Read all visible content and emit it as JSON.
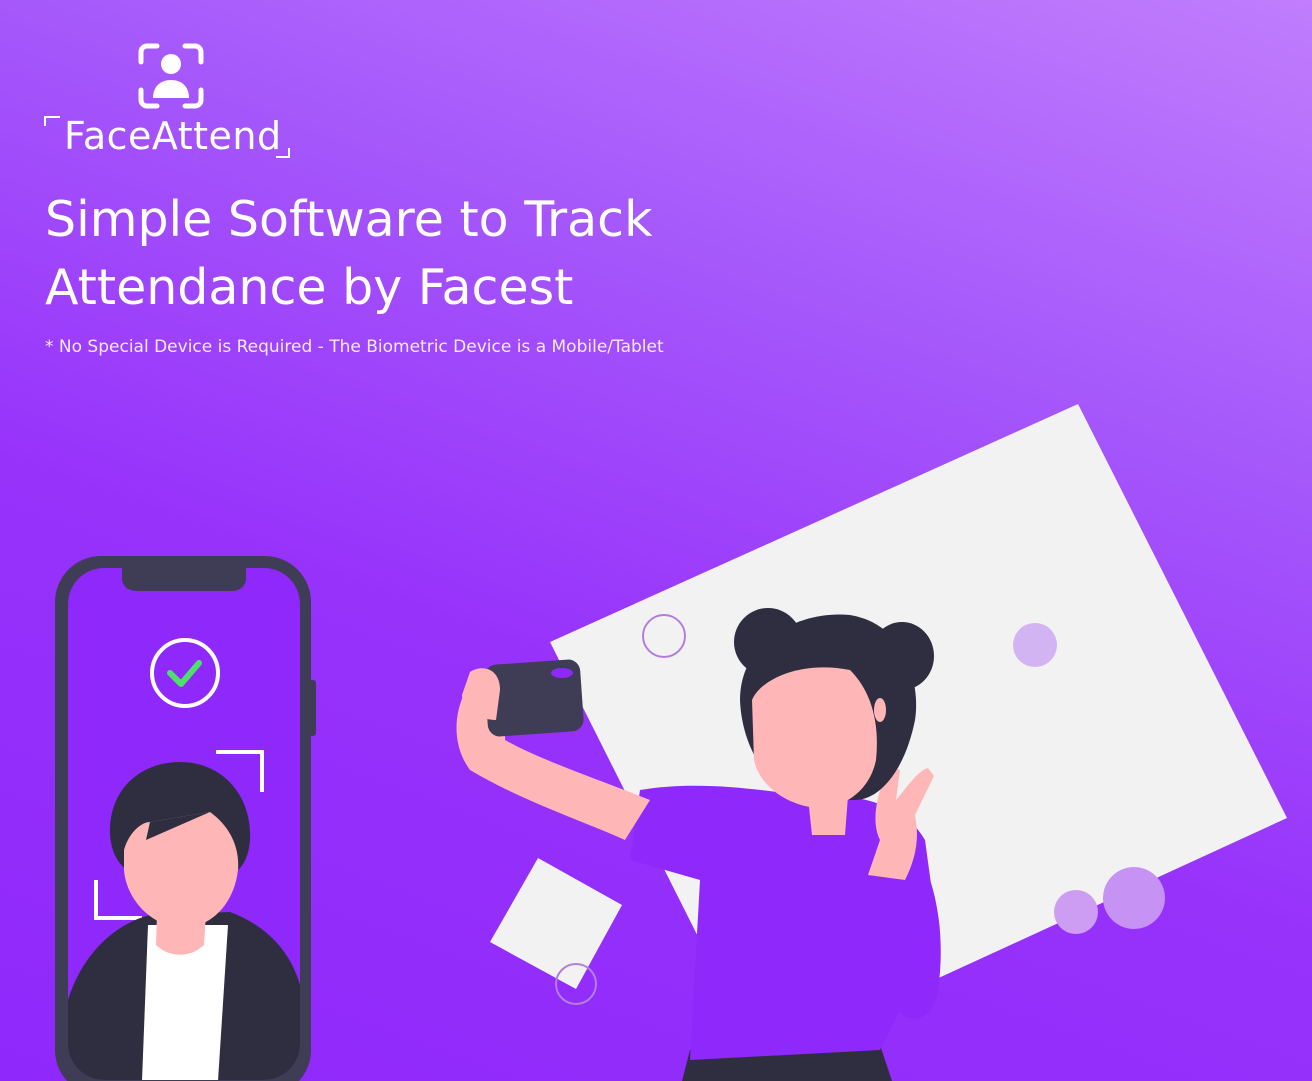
{
  "brand": {
    "name": "FaceAttend"
  },
  "hero": {
    "headline_line1": "Simple Software to Track",
    "headline_line2": "Attendance by Facest",
    "subtext": "* No Special Device is Required - The Biometric Device is a Mobile/Tablet"
  },
  "colors": {
    "background_top": "#c07dfd",
    "background_bottom": "#8f28fb",
    "phone_frame": "#3f3d56",
    "phone_screen": "#8f28fb",
    "skin": "#ffb6b6",
    "hair": "#2f2e41",
    "shirt": "#8f28fb",
    "card": "#f2f2f2",
    "check": "#4ee06a",
    "bubble": "#d3b4f2"
  },
  "icons": {
    "logo": "face-scan-icon",
    "verified": "check-circle-icon"
  }
}
